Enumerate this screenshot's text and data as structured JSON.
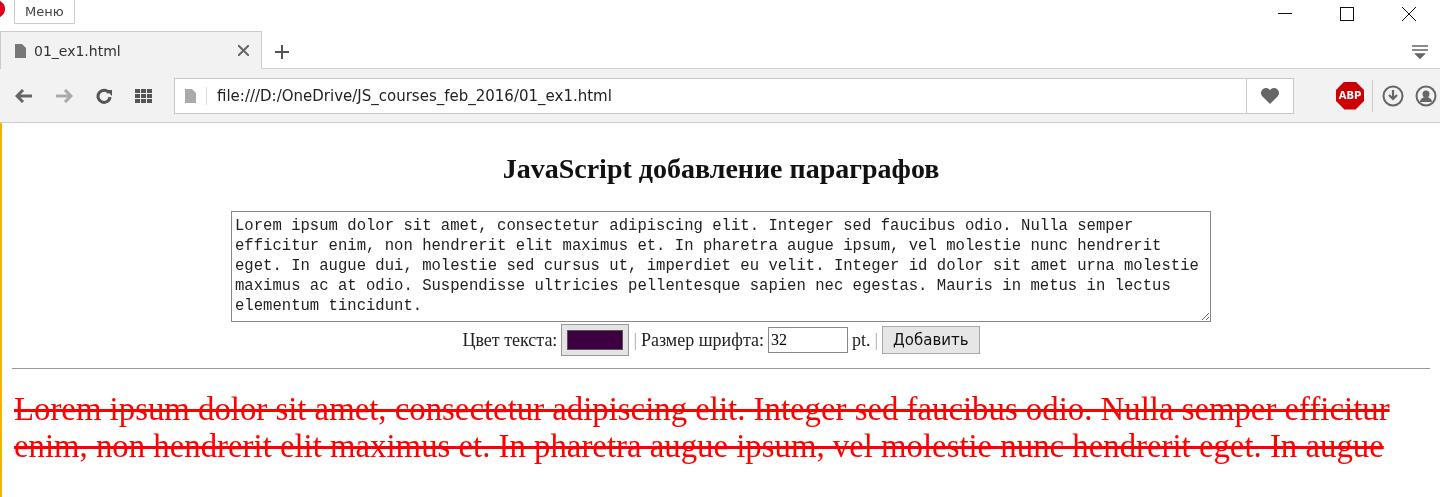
{
  "window": {
    "menu_label": "Меню"
  },
  "tabs": [
    {
      "label": "01_ex1.html",
      "selected": true
    }
  ],
  "address_bar": {
    "url": "file:///D:/OneDrive/JS_courses_feb_2016/01_ex1.html"
  },
  "toolbar": {
    "adblock_label": "ABP"
  },
  "page": {
    "heading": "JavaScript добавление параграфов",
    "textarea_value": "Lorem ipsum dolor sit amet, consectetur adipiscing elit. Integer sed faucibus odio. Nulla semper efficitur enim, non hendrerit elit maximus et. In pharetra augue ipsum, vel molestie nunc hendrerit eget. In augue dui, molestie sed cursus ut, imperdiet eu velit. Integer id dolor sit amet urna molestie maximus ac at odio. Suspendisse ultricies pellentesque sapien nec egestas. Mauris in metus in lectus elementum tincidunt.",
    "color_label": "Цвет текста:",
    "color_picker": {
      "color": "#3d0040"
    },
    "separator_1": "|",
    "size_label": "Размер шрифта:",
    "size_value": "32",
    "size_unit": "pt.",
    "separator_2": "|",
    "add_button": "Добавить",
    "paragraphs": [
      {
        "text": "Lorem ipsum dolor sit amet, consectetur adipiscing elit. Integer sed faucibus odio. Nulla semper efficitur enim, non hendrerit elit maximus et. In pharetra augue ipsum, vel molestie nunc hendrerit eget. In augue",
        "color": "#ff0000",
        "strikethrough": true
      }
    ]
  }
}
